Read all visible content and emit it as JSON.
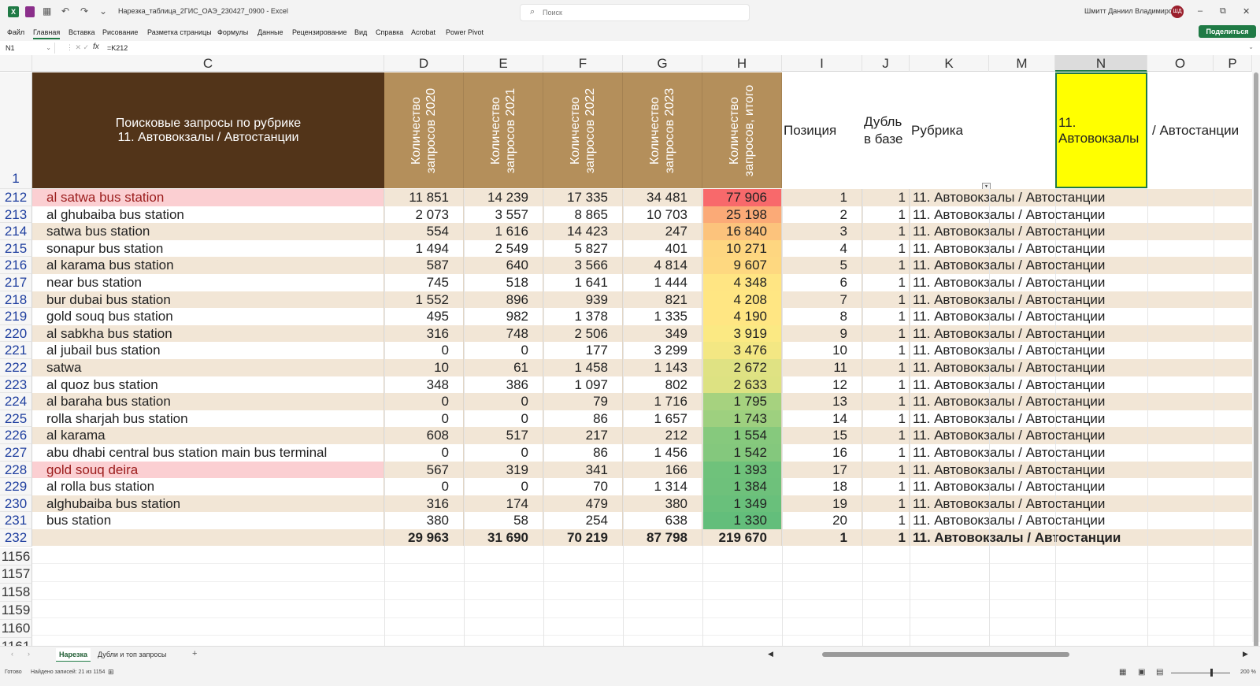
{
  "window": {
    "file_name": "Нарезка_таблица_2ГИС_ОАЭ_230427_0900",
    "app_name": "Excel",
    "search_placeholder": "Поиск",
    "user_name": "Шмитт Даниил Владимирович",
    "user_initials": "ШД",
    "app_icon_label": "X",
    "min_glyph": "–",
    "max_glyph": "⧉",
    "close_glyph": "✕"
  },
  "quick_access": {
    "undo": "↶",
    "redo": "↷",
    "more": "⌄"
  },
  "ribbon": {
    "tabs": [
      "Файл",
      "Главная",
      "Вставка",
      "Рисование",
      "Разметка страницы",
      "Формулы",
      "Данные",
      "Рецензирование",
      "Вид",
      "Справка",
      "Acrobat",
      "Power Pivot"
    ],
    "active_tab": "Главная",
    "share_label": "Поделиться"
  },
  "formula_bar": {
    "cell_ref": "N1",
    "fx": "fx",
    "formula": "=K212"
  },
  "columns": [
    "C",
    "D",
    "E",
    "F",
    "G",
    "H",
    "I",
    "J",
    "K",
    "M",
    "N",
    "O",
    "P"
  ],
  "selected_column": "N",
  "header_row": {
    "row_num": "1",
    "title": "Поисковые запросы по рубрике",
    "subtitle": "11. Автовокзалы / Автостанции",
    "year_headers": [
      "Количество запросов 2020",
      "Количество запросов 2021",
      "Количество запросов 2022",
      "Количество запросов 2023",
      "Количество запросов, итого"
    ],
    "position": "Позиция",
    "duplicate": "Дубль в базе",
    "rubric": "Рубрика",
    "n_value_left": "11. Автовокзалы",
    "n_value_right": "/ Автостанции"
  },
  "rows": [
    {
      "num": "212",
      "query": "al satwa bus station",
      "y2020": "11 851",
      "y2021": "14 239",
      "y2022": "17 335",
      "y2023": "34 481",
      "total": "77 906",
      "pos": "1",
      "dup": "1",
      "rubric": "11. Автовокзалы / Автостанции",
      "heat": "#f8696b",
      "pink": true
    },
    {
      "num": "213",
      "query": "al ghubaiba bus station",
      "y2020": "2 073",
      "y2021": "3 557",
      "y2022": "8 865",
      "y2023": "10 703",
      "total": "25 198",
      "pos": "2",
      "dup": "1",
      "rubric": "11. Автовокзалы / Автостанции",
      "heat": "#fbaa77",
      "pink": false
    },
    {
      "num": "214",
      "query": "satwa bus station",
      "y2020": "554",
      "y2021": "1 616",
      "y2022": "14 423",
      "y2023": "247",
      "total": "16 840",
      "pos": "3",
      "dup": "1",
      "rubric": "11. Автовокзалы / Автостанции",
      "heat": "#fcc37c",
      "pink": false
    },
    {
      "num": "215",
      "query": "sonapur bus station",
      "y2020": "1 494",
      "y2021": "2 549",
      "y2022": "5 827",
      "y2023": "401",
      "total": "10 271",
      "pos": "4",
      "dup": "1",
      "rubric": "11. Автовокзалы / Автостанции",
      "heat": "#fed680",
      "pink": false
    },
    {
      "num": "216",
      "query": "al karama bus station",
      "y2020": "587",
      "y2021": "640",
      "y2022": "3 566",
      "y2023": "4 814",
      "total": "9 607",
      "pos": "5",
      "dup": "1",
      "rubric": "11. Автовокзалы / Автостанции",
      "heat": "#fed880",
      "pink": false
    },
    {
      "num": "217",
      "query": "near bus station",
      "y2020": "745",
      "y2021": "518",
      "y2022": "1 641",
      "y2023": "1 444",
      "total": "4 348",
      "pos": "6",
      "dup": "1",
      "rubric": "11. Автовокзалы / Автостанции",
      "heat": "#ffe583",
      "pink": false
    },
    {
      "num": "218",
      "query": "bur dubai bus station",
      "y2020": "1 552",
      "y2021": "896",
      "y2022": "939",
      "y2023": "821",
      "total": "4 208",
      "pos": "7",
      "dup": "1",
      "rubric": "11. Автовокзалы / Автостанции",
      "heat": "#ffe683",
      "pink": false
    },
    {
      "num": "219",
      "query": "gold souq bus station",
      "y2020": "495",
      "y2021": "982",
      "y2022": "1 378",
      "y2023": "1 335",
      "total": "4 190",
      "pos": "8",
      "dup": "1",
      "rubric": "11. Автовокзалы / Автостанции",
      "heat": "#ffe683",
      "pink": false
    },
    {
      "num": "220",
      "query": "al sabkha bus station",
      "y2020": "316",
      "y2021": "748",
      "y2022": "2 506",
      "y2023": "349",
      "total": "3 919",
      "pos": "9",
      "dup": "1",
      "rubric": "11. Автовокзалы / Автостанции",
      "heat": "#fbe983",
      "pink": false
    },
    {
      "num": "221",
      "query": "al jubail bus station",
      "y2020": "0",
      "y2021": "0",
      "y2022": "177",
      "y2023": "3 299",
      "total": "3 476",
      "pos": "10",
      "dup": "1",
      "rubric": "11. Автовокзалы / Автостанции",
      "heat": "#f3e783",
      "pink": false
    },
    {
      "num": "222",
      "query": "satwa",
      "y2020": "10",
      "y2021": "61",
      "y2022": "1 458",
      "y2023": "1 143",
      "total": "2 672",
      "pos": "11",
      "dup": "1",
      "rubric": "11. Автовокзалы / Автостанции",
      "heat": "#dfe283",
      "pink": false
    },
    {
      "num": "223",
      "query": "al quoz bus station",
      "y2020": "348",
      "y2021": "386",
      "y2022": "1 097",
      "y2023": "802",
      "total": "2 633",
      "pos": "12",
      "dup": "1",
      "rubric": "11. Автовокзалы / Автостанции",
      "heat": "#dde282",
      "pink": false
    },
    {
      "num": "224",
      "query": "al baraha bus station",
      "y2020": "0",
      "y2021": "0",
      "y2022": "79",
      "y2023": "1 716",
      "total": "1 795",
      "pos": "13",
      "dup": "1",
      "rubric": "11. Автовокзалы / Автостанции",
      "heat": "#a6d27f",
      "pink": false
    },
    {
      "num": "225",
      "query": "rolla sharjah bus station",
      "y2020": "0",
      "y2021": "0",
      "y2022": "86",
      "y2023": "1 657",
      "total": "1 743",
      "pos": "14",
      "dup": "1",
      "rubric": "11. Автовокзалы / Автостанции",
      "heat": "#9ed07f",
      "pink": false
    },
    {
      "num": "226",
      "query": "al karama",
      "y2020": "608",
      "y2021": "517",
      "y2022": "217",
      "y2023": "212",
      "total": "1 554",
      "pos": "15",
      "dup": "1",
      "rubric": "11. Автовокзалы / Автостанции",
      "heat": "#86c97d",
      "pink": false
    },
    {
      "num": "227",
      "query": "abu dhabi central bus station main bus terminal",
      "y2020": "0",
      "y2021": "0",
      "y2022": "86",
      "y2023": "1 456",
      "total": "1 542",
      "pos": "16",
      "dup": "1",
      "rubric": "11. Автовокзалы / Автостанции",
      "heat": "#84c87d",
      "pink": false
    },
    {
      "num": "228",
      "query": "gold souq deira",
      "y2020": "567",
      "y2021": "319",
      "y2022": "341",
      "y2023": "166",
      "total": "1 393",
      "pos": "17",
      "dup": "1",
      "rubric": "11. Автовокзалы / Автостанции",
      "heat": "#6fc27b",
      "pink": true
    },
    {
      "num": "229",
      "query": "al rolla bus station",
      "y2020": "0",
      "y2021": "0",
      "y2022": "70",
      "y2023": "1 314",
      "total": "1 384",
      "pos": "18",
      "dup": "1",
      "rubric": "11. Автовокзалы / Автостанции",
      "heat": "#6ec17b",
      "pink": false
    },
    {
      "num": "230",
      "query": "alghubaiba bus station",
      "y2020": "316",
      "y2021": "174",
      "y2022": "479",
      "y2023": "380",
      "total": "1 349",
      "pos": "19",
      "dup": "1",
      "rubric": "11. Автовокзалы / Автостанции",
      "heat": "#69c07b",
      "pink": false
    },
    {
      "num": "231",
      "query": "bus station",
      "y2020": "380",
      "y2021": "58",
      "y2022": "254",
      "y2023": "638",
      "total": "1 330",
      "pos": "20",
      "dup": "1",
      "rubric": "11. Автовокзалы / Автостанции",
      "heat": "#63be7b",
      "pink": false
    }
  ],
  "total_row": {
    "num": "232",
    "y2020": "29 963",
    "y2021": "31 690",
    "y2022": "70 219",
    "y2023": "87 798",
    "total": "219 670",
    "pos": "1",
    "dup": "1",
    "rubric": "11. Автовокзалы / Автостанции"
  },
  "empty_rows": [
    "1156",
    "1157",
    "1158",
    "1159",
    "1160",
    "1161"
  ],
  "sheets": [
    "Нарезка",
    "Дубли и топ запросы"
  ],
  "active_sheet": "Нарезка",
  "add_sheet": "+",
  "status": {
    "ready": "Готово",
    "filter": "Найдено записей: 21 из 1154",
    "zoom": "200 %"
  }
}
